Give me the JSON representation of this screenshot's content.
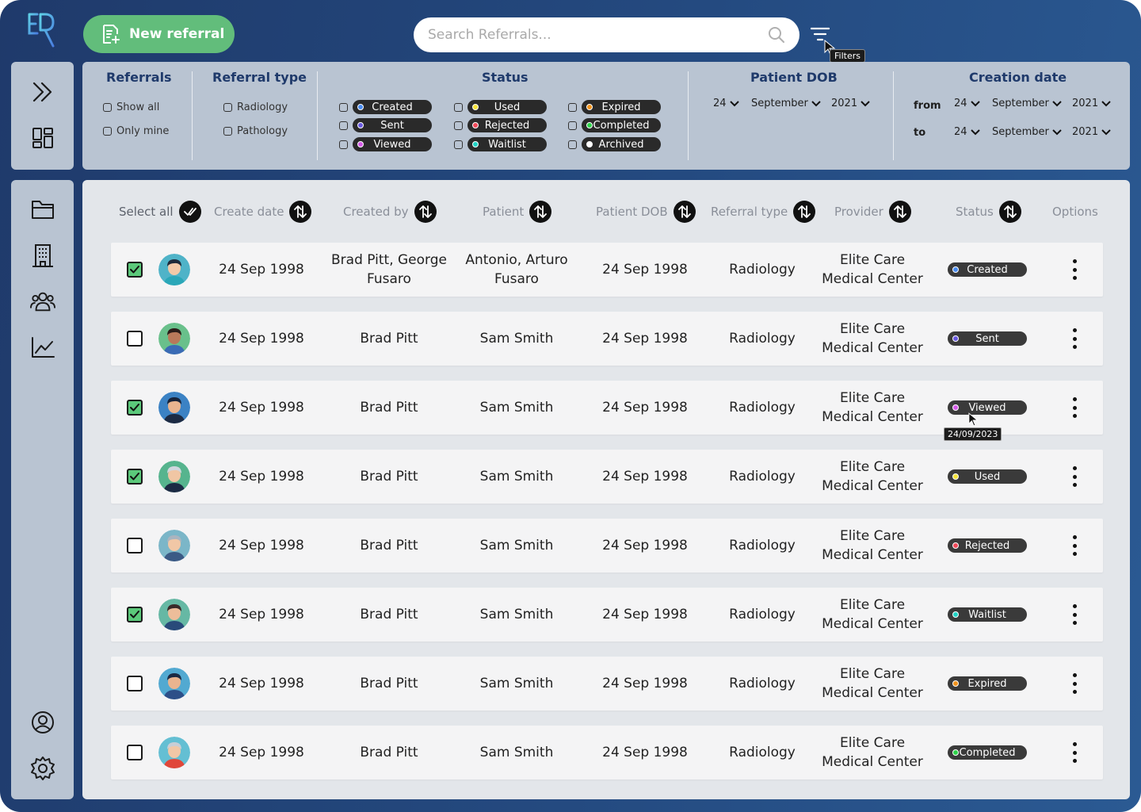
{
  "header": {
    "new_referral_label": "New referral",
    "search_placeholder": "Search Referrals...",
    "filters_tooltip": "Filters"
  },
  "filters": {
    "referrals": {
      "title": "Referrals",
      "options": [
        "Show all",
        "Only mine"
      ]
    },
    "referral_type": {
      "title": "Referral type",
      "options": [
        "Radiology",
        "Pathology"
      ]
    },
    "status": {
      "title": "Status",
      "options": [
        {
          "label": "Created",
          "color": "#4a8cf0"
        },
        {
          "label": "Used",
          "color": "#f5e33a"
        },
        {
          "label": "Expired",
          "color": "#f2941e"
        },
        {
          "label": "Sent",
          "color": "#6a5ae0"
        },
        {
          "label": "Rejected",
          "color": "#ef4a5a"
        },
        {
          "label": "Completed",
          "color": "#2ed34a"
        },
        {
          "label": "Viewed",
          "color": "#d55be8"
        },
        {
          "label": "Waitlist",
          "color": "#22d3c5"
        },
        {
          "label": "Archived",
          "color": "#ffffff"
        }
      ]
    },
    "patient_dob": {
      "title": "Patient DOB",
      "day": "24",
      "month": "September",
      "year": "2021"
    },
    "creation_date": {
      "title": "Creation date",
      "from_label": "from",
      "to_label": "to",
      "from": {
        "day": "24",
        "month": "September",
        "year": "2021"
      },
      "to": {
        "day": "24",
        "month": "September",
        "year": "2021"
      }
    }
  },
  "table": {
    "headers": {
      "select_all": "Select all",
      "create_date": "Create date",
      "created_by": "Created by",
      "patient": "Patient",
      "patient_dob": "Patient DOB",
      "referral_type": "Referral type",
      "provider": "Provider",
      "status": "Status",
      "options": "Options"
    },
    "rows": [
      {
        "checked": true,
        "create_date": "24 Sep 1998",
        "created_by": "Brad Pitt, George Fusaro",
        "patient": "Antonio, Arturo Fusaro",
        "dob": "24 Sep 1998",
        "type": "Radiology",
        "provider": "Elite Care Medical Center",
        "status": "Created",
        "status_color": "#4a8cf0"
      },
      {
        "checked": false,
        "create_date": "24 Sep 1998",
        "created_by": "Brad Pitt",
        "patient": "Sam Smith",
        "dob": "24 Sep 1998",
        "type": "Radiology",
        "provider": "Elite Care Medical Center",
        "status": "Sent",
        "status_color": "#6a5ae0"
      },
      {
        "checked": true,
        "create_date": "24 Sep 1998",
        "created_by": "Brad Pitt",
        "patient": "Sam Smith",
        "dob": "24 Sep 1998",
        "type": "Radiology",
        "provider": "Elite Care Medical Center",
        "status": "Viewed",
        "status_color": "#d55be8"
      },
      {
        "checked": true,
        "create_date": "24 Sep 1998",
        "created_by": "Brad Pitt",
        "patient": "Sam Smith",
        "dob": "24 Sep 1998",
        "type": "Radiology",
        "provider": "Elite Care Medical Center",
        "status": "Used",
        "status_color": "#f5e33a"
      },
      {
        "checked": false,
        "create_date": "24 Sep 1998",
        "created_by": "Brad Pitt",
        "patient": "Sam Smith",
        "dob": "24 Sep 1998",
        "type": "Radiology",
        "provider": "Elite Care Medical Center",
        "status": "Rejected",
        "status_color": "#ef4a5a"
      },
      {
        "checked": true,
        "create_date": "24 Sep 1998",
        "created_by": "Brad Pitt",
        "patient": "Sam Smith",
        "dob": "24 Sep 1998",
        "type": "Radiology",
        "provider": "Elite Care Medical Center",
        "status": "Waitlist",
        "status_color": "#22d3c5"
      },
      {
        "checked": false,
        "create_date": "24 Sep 1998",
        "created_by": "Brad Pitt",
        "patient": "Sam Smith",
        "dob": "24 Sep 1998",
        "type": "Radiology",
        "provider": "Elite Care Medical Center",
        "status": "Expired",
        "status_color": "#f2941e"
      },
      {
        "checked": false,
        "create_date": "24 Sep 1998",
        "created_by": "Brad Pitt",
        "patient": "Sam Smith",
        "dob": "24 Sep 1998",
        "type": "Radiology",
        "provider": "Elite Care Medical Center",
        "status": "Completed",
        "status_color": "#2ed34a"
      }
    ],
    "hover_tooltip": "24/09/2023"
  },
  "colors": {
    "accent_green": "#62bd7b",
    "background": "#1f3a6b",
    "panel": "#b9c4d2",
    "table_bg": "#e3e6ea"
  },
  "icons": [
    "logo-icon",
    "new-referral-icon",
    "search-icon",
    "filter-icon",
    "expand-icon",
    "dashboard-icon",
    "folder-icon",
    "building-icon",
    "users-icon",
    "chart-icon",
    "profile-icon",
    "settings-icon",
    "sort-icon",
    "checkmark-icon",
    "kebab-icon"
  ]
}
